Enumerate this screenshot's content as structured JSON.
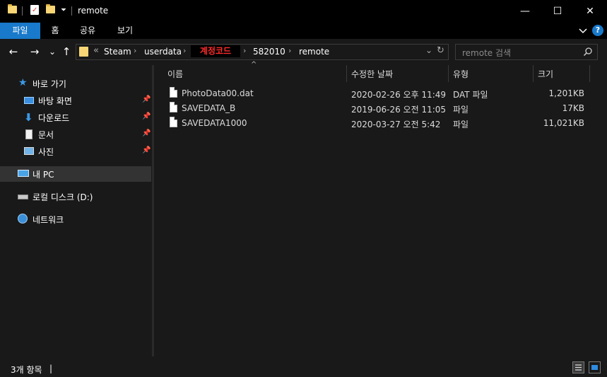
{
  "window": {
    "title": "remote",
    "minimize": "—",
    "maximize": "☐",
    "close": "✕"
  },
  "ribbon": {
    "tabs": [
      "파일",
      "홈",
      "공유",
      "보기"
    ],
    "expand_icon": "chevron-down-icon",
    "help_icon": "?"
  },
  "nav_buttons": {
    "back": "←",
    "forward": "→",
    "recent": "⌄",
    "up": "↑"
  },
  "address": {
    "overflow": "«",
    "crumbs": [
      "Steam",
      "userdata",
      "계정코드",
      "582010",
      "remote"
    ],
    "separator": "›",
    "dropdown": "⌄",
    "refresh": "↻"
  },
  "search": {
    "placeholder": "remote 검색",
    "icon": "search-icon"
  },
  "sidebar": {
    "quick_access": "바로 가기",
    "pinned": [
      {
        "label": "바탕 화면",
        "icon": "desktop-icon"
      },
      {
        "label": "다운로드",
        "icon": "download-icon"
      },
      {
        "label": "문서",
        "icon": "document-icon"
      },
      {
        "label": "사진",
        "icon": "pictures-icon"
      }
    ],
    "this_pc": "내 PC",
    "local_disk": "로컬 디스크 (D:)",
    "network": "네트워크"
  },
  "columns": {
    "name": "이름",
    "modified": "수정한 날짜",
    "type": "유형",
    "size": "크기",
    "sort_indicator": "^"
  },
  "files": [
    {
      "name": "PhotoData00.dat",
      "modified": "2020-02-26 오후 11:49",
      "type": "DAT 파일",
      "size": "1,201KB"
    },
    {
      "name": "SAVEDATA_B",
      "modified": "2019-06-26 오전 11:05",
      "type": "파일",
      "size": "17KB"
    },
    {
      "name": "SAVEDATA1000",
      "modified": "2020-03-27 오전 5:42",
      "type": "파일",
      "size": "11,021KB"
    }
  ],
  "status": {
    "item_count": "3개 항목",
    "cursor": "|"
  },
  "colors": {
    "accent": "#1979ca",
    "background": "#191919",
    "titlebar": "#000000",
    "highlight_text": "#ff2b2b"
  }
}
